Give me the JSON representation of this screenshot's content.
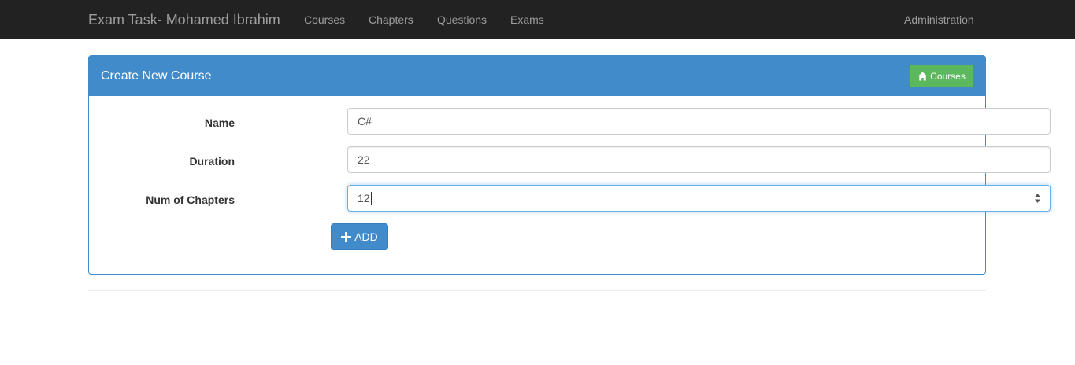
{
  "navbar": {
    "brand": "Exam Task- Mohamed Ibrahim",
    "links": [
      {
        "label": "Courses"
      },
      {
        "label": "Chapters"
      },
      {
        "label": "Questions"
      },
      {
        "label": "Exams"
      }
    ],
    "right_link": "Administration"
  },
  "panel": {
    "title": "Create New Course",
    "courses_button": {
      "label": "Courses",
      "icon": "home-icon"
    }
  },
  "form": {
    "fields": [
      {
        "label": "Name",
        "value": "C#"
      },
      {
        "label": "Duration",
        "value": "22"
      },
      {
        "label": "Num of Chapters",
        "value": "12"
      }
    ],
    "submit": {
      "label": "ADD",
      "icon": "plus-icon"
    }
  },
  "colors": {
    "navbar": "#222222",
    "primary": "#428bca",
    "success": "#5cb85c"
  }
}
